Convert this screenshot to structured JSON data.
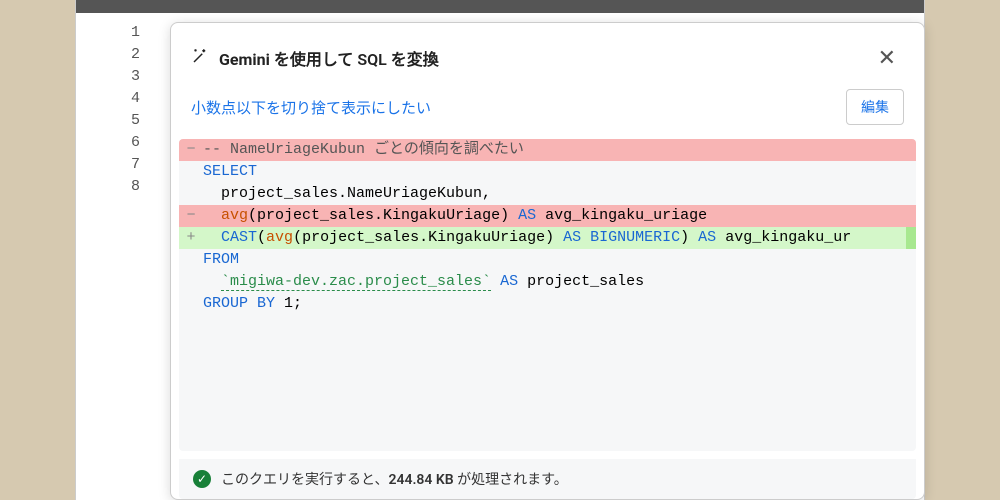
{
  "editor": {
    "line_numbers": [
      "1",
      "2",
      "3",
      "4",
      "5",
      "6",
      "7",
      "8"
    ]
  },
  "modal": {
    "title_prefix": "Gemini",
    "title_suffix": " を使用して SQL を変換",
    "close_glyph": "✕",
    "prompt": "小数点以下を切り捨て表示にしたい",
    "edit_label": "編集"
  },
  "code": {
    "l1_marker": "−",
    "l1_text": "-- NameUriageKubun ごとの傾向を調べたい",
    "l2_marker": "",
    "l2_kw": "SELECT",
    "l3_marker": "",
    "l3_text": "  project_sales.NameUriageKubun,",
    "l4_marker": "−",
    "l4_fn": "avg",
    "l4_mid": "(project_sales.KingakuUriage) ",
    "l4_as": "AS",
    "l4_tail": " avg_kingaku_uriage",
    "l5_marker": "+",
    "l5_cast": "CAST",
    "l5_open": "(",
    "l5_fn": "avg",
    "l5_mid": "(project_sales.KingakuUriage) ",
    "l5_as": "AS",
    "l5_type": " BIGNUMERIC",
    "l5_close": ") ",
    "l5_as2": "AS",
    "l5_tail": " avg_kingaku_ur",
    "l6_marker": "",
    "l6_kw": "FROM",
    "l7_marker": "",
    "l7_tbl": "`migiwa-dev.zac.project_sales`",
    "l7_as": " AS",
    "l7_tail": " project_sales",
    "l8_marker": "",
    "l8_kw": "GROUP BY",
    "l8_tail": " 1;"
  },
  "status": {
    "check_glyph": "✓",
    "prefix": "このクエリを実行すると、",
    "size": "244.84 KB",
    "suffix": " が処理されます。"
  }
}
